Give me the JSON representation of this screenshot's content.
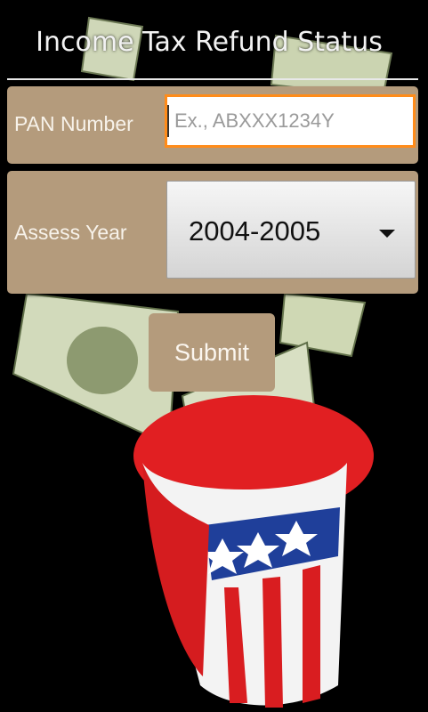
{
  "header": {
    "title": "Income Tax Refund Status"
  },
  "form": {
    "pan_label": "PAN Number",
    "pan_placeholder": "Ex., ABXXX1234Y",
    "pan_value": "",
    "year_label": "Assess Year",
    "year_selected": "2004-2005",
    "submit_label": "Submit"
  },
  "colors": {
    "panel": "#b49b7c",
    "focus_border": "#ff8c1a",
    "background": "#000000"
  },
  "background_image": {
    "icon": "uncle-sam-hat-with-dollar-bills"
  }
}
